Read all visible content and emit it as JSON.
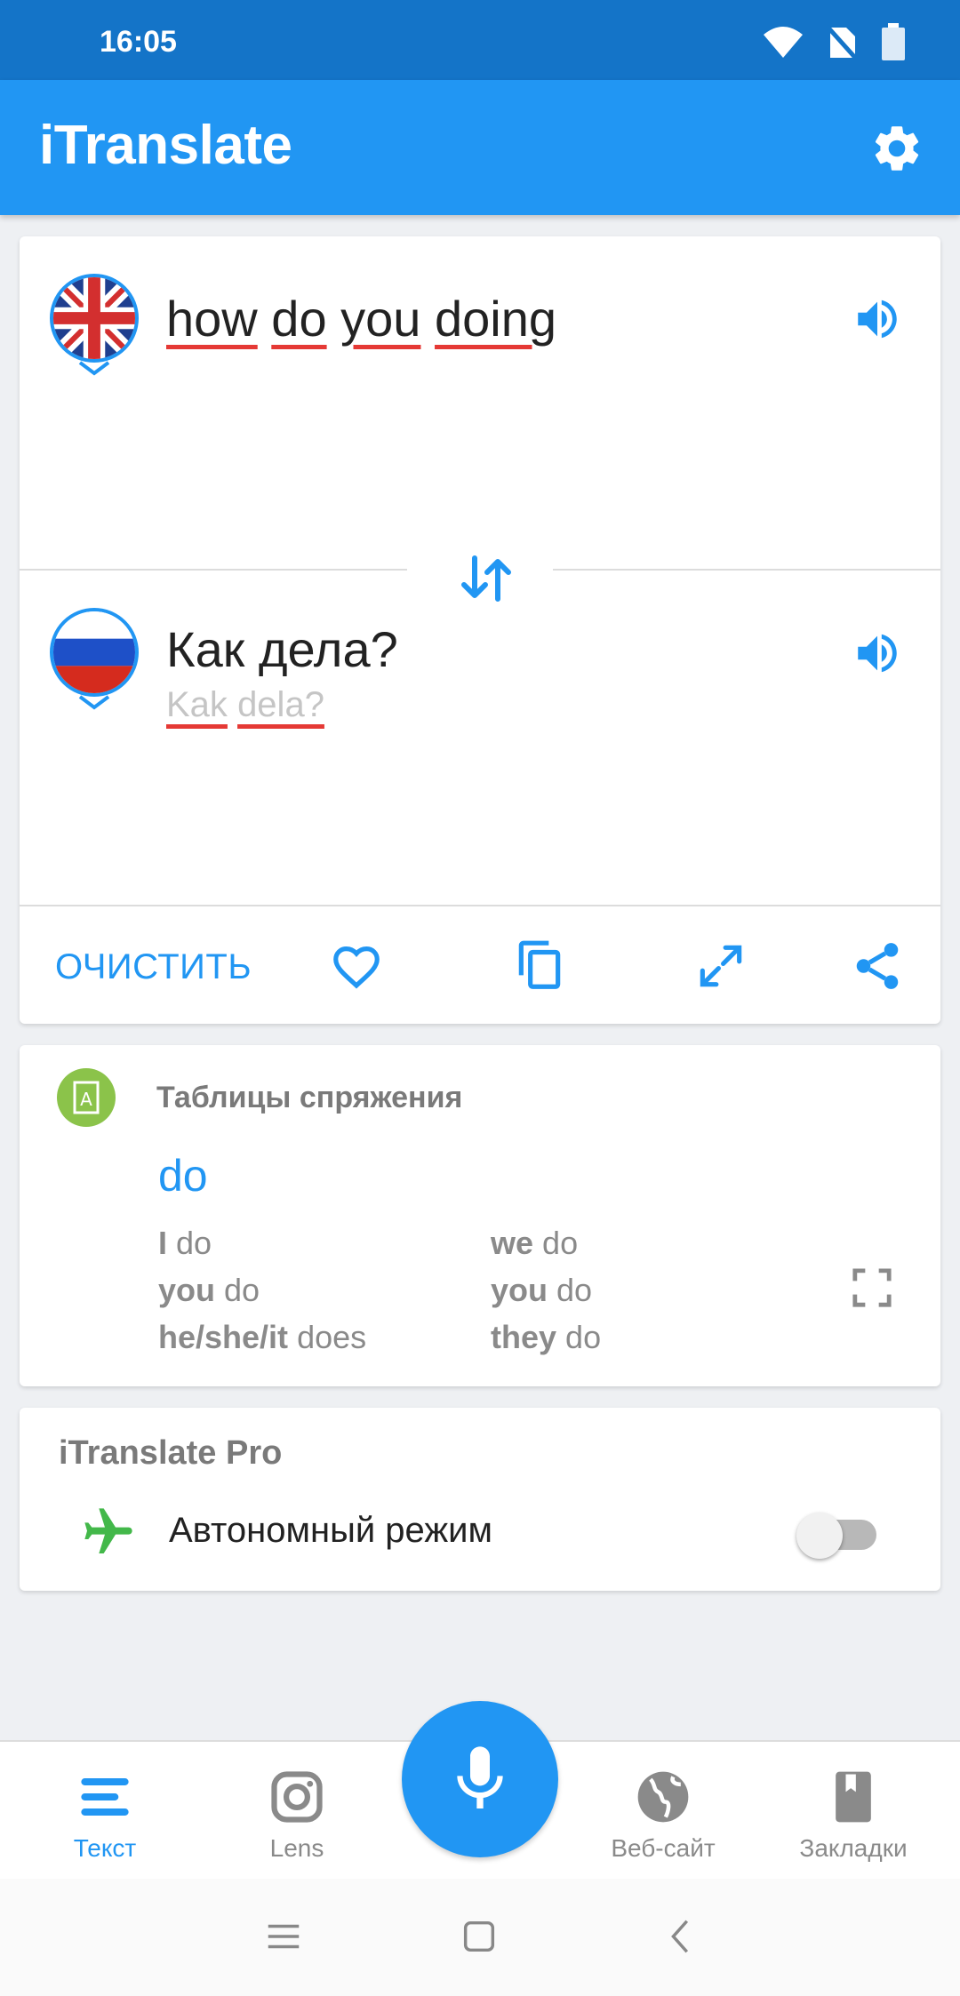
{
  "status_bar": {
    "time": "16:05"
  },
  "app_bar": {
    "title": "iTranslate"
  },
  "translation": {
    "source_words": [
      "how",
      "do",
      "you",
      "doing"
    ],
    "target_text": "Как дела?",
    "target_translit_words": [
      "Kak",
      "dela?"
    ],
    "source_language_flag": "uk-flag",
    "target_language_flag": "russia-flag"
  },
  "actions": {
    "clear_label": "ОЧИСТИТЬ"
  },
  "conjugation": {
    "title": "Таблицы спряжения",
    "verb": "do",
    "left": [
      {
        "pronoun": "I",
        "form": "do"
      },
      {
        "pronoun": "you",
        "form": "do"
      },
      {
        "pronoun": "he/she/it",
        "form": "does"
      }
    ],
    "right": [
      {
        "pronoun": "we",
        "form": "do"
      },
      {
        "pronoun": "you",
        "form": "do"
      },
      {
        "pronoun": "they",
        "form": "do"
      }
    ]
  },
  "pro": {
    "title": "iTranslate Pro",
    "offline_label": "Автономный режим",
    "offline_enabled": false
  },
  "bottom_nav": {
    "items": [
      {
        "label": "Текст",
        "icon": "text-lines-icon"
      },
      {
        "label": "Lens",
        "icon": "camera-icon"
      },
      {
        "label": "Веб-сайт",
        "icon": "globe-icon"
      },
      {
        "label": "Закладки",
        "icon": "bookmark-icon"
      }
    ],
    "active": "Текст"
  },
  "colors": {
    "accent": "#2196f3",
    "status_bar": "#1474c8",
    "underline": "#e53935",
    "conj_icon": "#8bc34a",
    "plane": "#43b84a"
  }
}
